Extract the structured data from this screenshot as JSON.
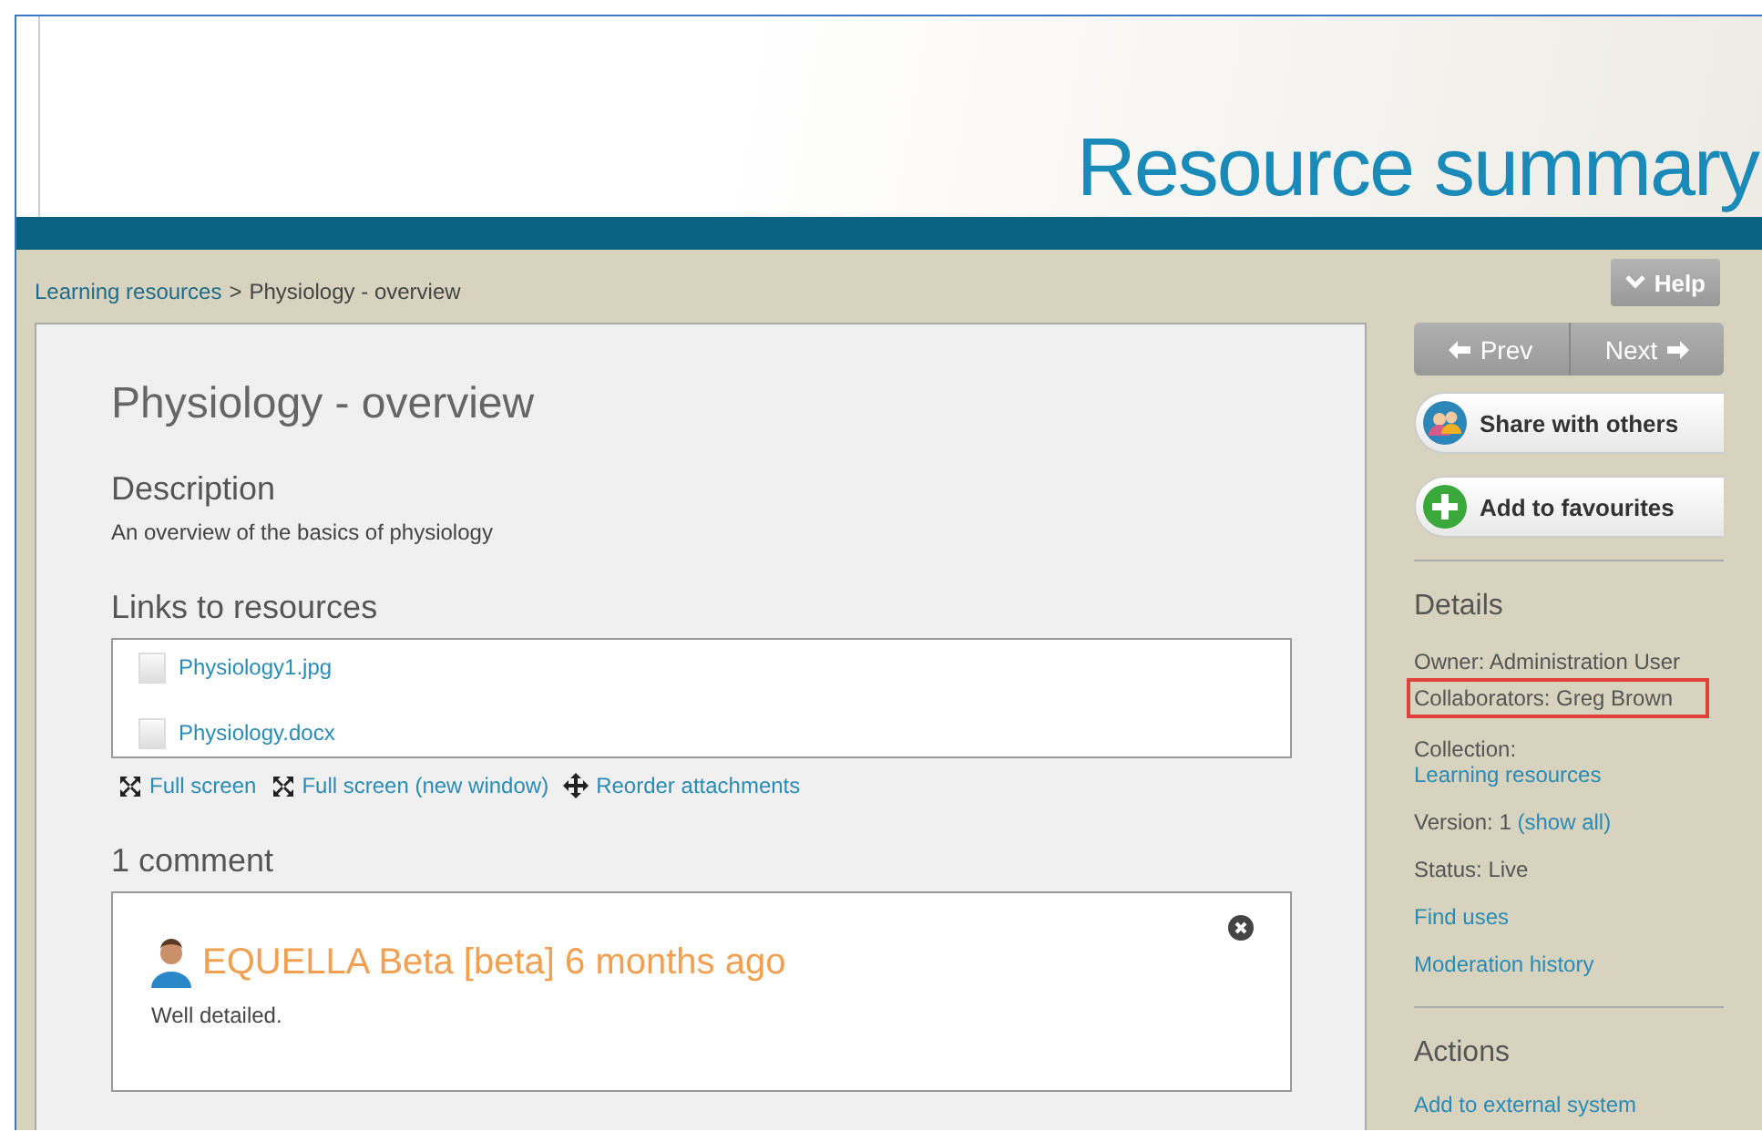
{
  "header": {
    "title": "Resource summary"
  },
  "breadcrumb": [
    {
      "label": "Learning resources",
      "kind": "link"
    },
    {
      "label": ">",
      "kind": "separator"
    },
    {
      "label": "Physiology - overview",
      "kind": "text"
    }
  ],
  "help_button": {
    "label": "Help"
  },
  "item": {
    "title": "Physiology - overview",
    "description_heading": "Description",
    "description": "An overview of the basics of physiology",
    "links_heading": "Links to resources",
    "attachments": [
      {
        "name": "Physiology1.jpg"
      },
      {
        "name": "Physiology.docx"
      }
    ],
    "attachment_actions": [
      {
        "label": "Full screen",
        "kind": "fullscreen"
      },
      {
        "label": "Full screen (new window)",
        "kind": "fullscreen"
      },
      {
        "label": "Reorder attachments",
        "kind": "move"
      }
    ],
    "comments_heading": "1 comment",
    "comments": [
      {
        "author": "EQUELLA Beta [beta] 6 months ago",
        "text": "Well detailed."
      }
    ]
  },
  "sidebar": {
    "nav": [
      {
        "label": "Prev",
        "kind": "prev"
      },
      {
        "label": "Next",
        "kind": "next"
      }
    ],
    "buttons": [
      {
        "label": "Share with others",
        "kind": "share"
      },
      {
        "label": "Add to favourites",
        "kind": "add"
      }
    ],
    "details_heading": "Details",
    "details": [
      {
        "label": "Owner:",
        "value": "Administration User",
        "highlighted": false
      },
      {
        "label": "Collaborators:",
        "value": "Greg Brown",
        "highlighted": true
      },
      {
        "label": "Collection:",
        "link": "Learning resources",
        "highlighted": false
      },
      {
        "label": "Version:",
        "value": "1",
        "link": "(show all)",
        "highlighted": false
      },
      {
        "label": "Status:",
        "value": "Live",
        "highlighted": false
      },
      {
        "link": "Find uses",
        "highlighted": false
      },
      {
        "link": "Moderation history",
        "highlighted": false
      }
    ],
    "actions_heading": "Actions",
    "actions": [
      {
        "label": "Add to external system"
      }
    ]
  }
}
